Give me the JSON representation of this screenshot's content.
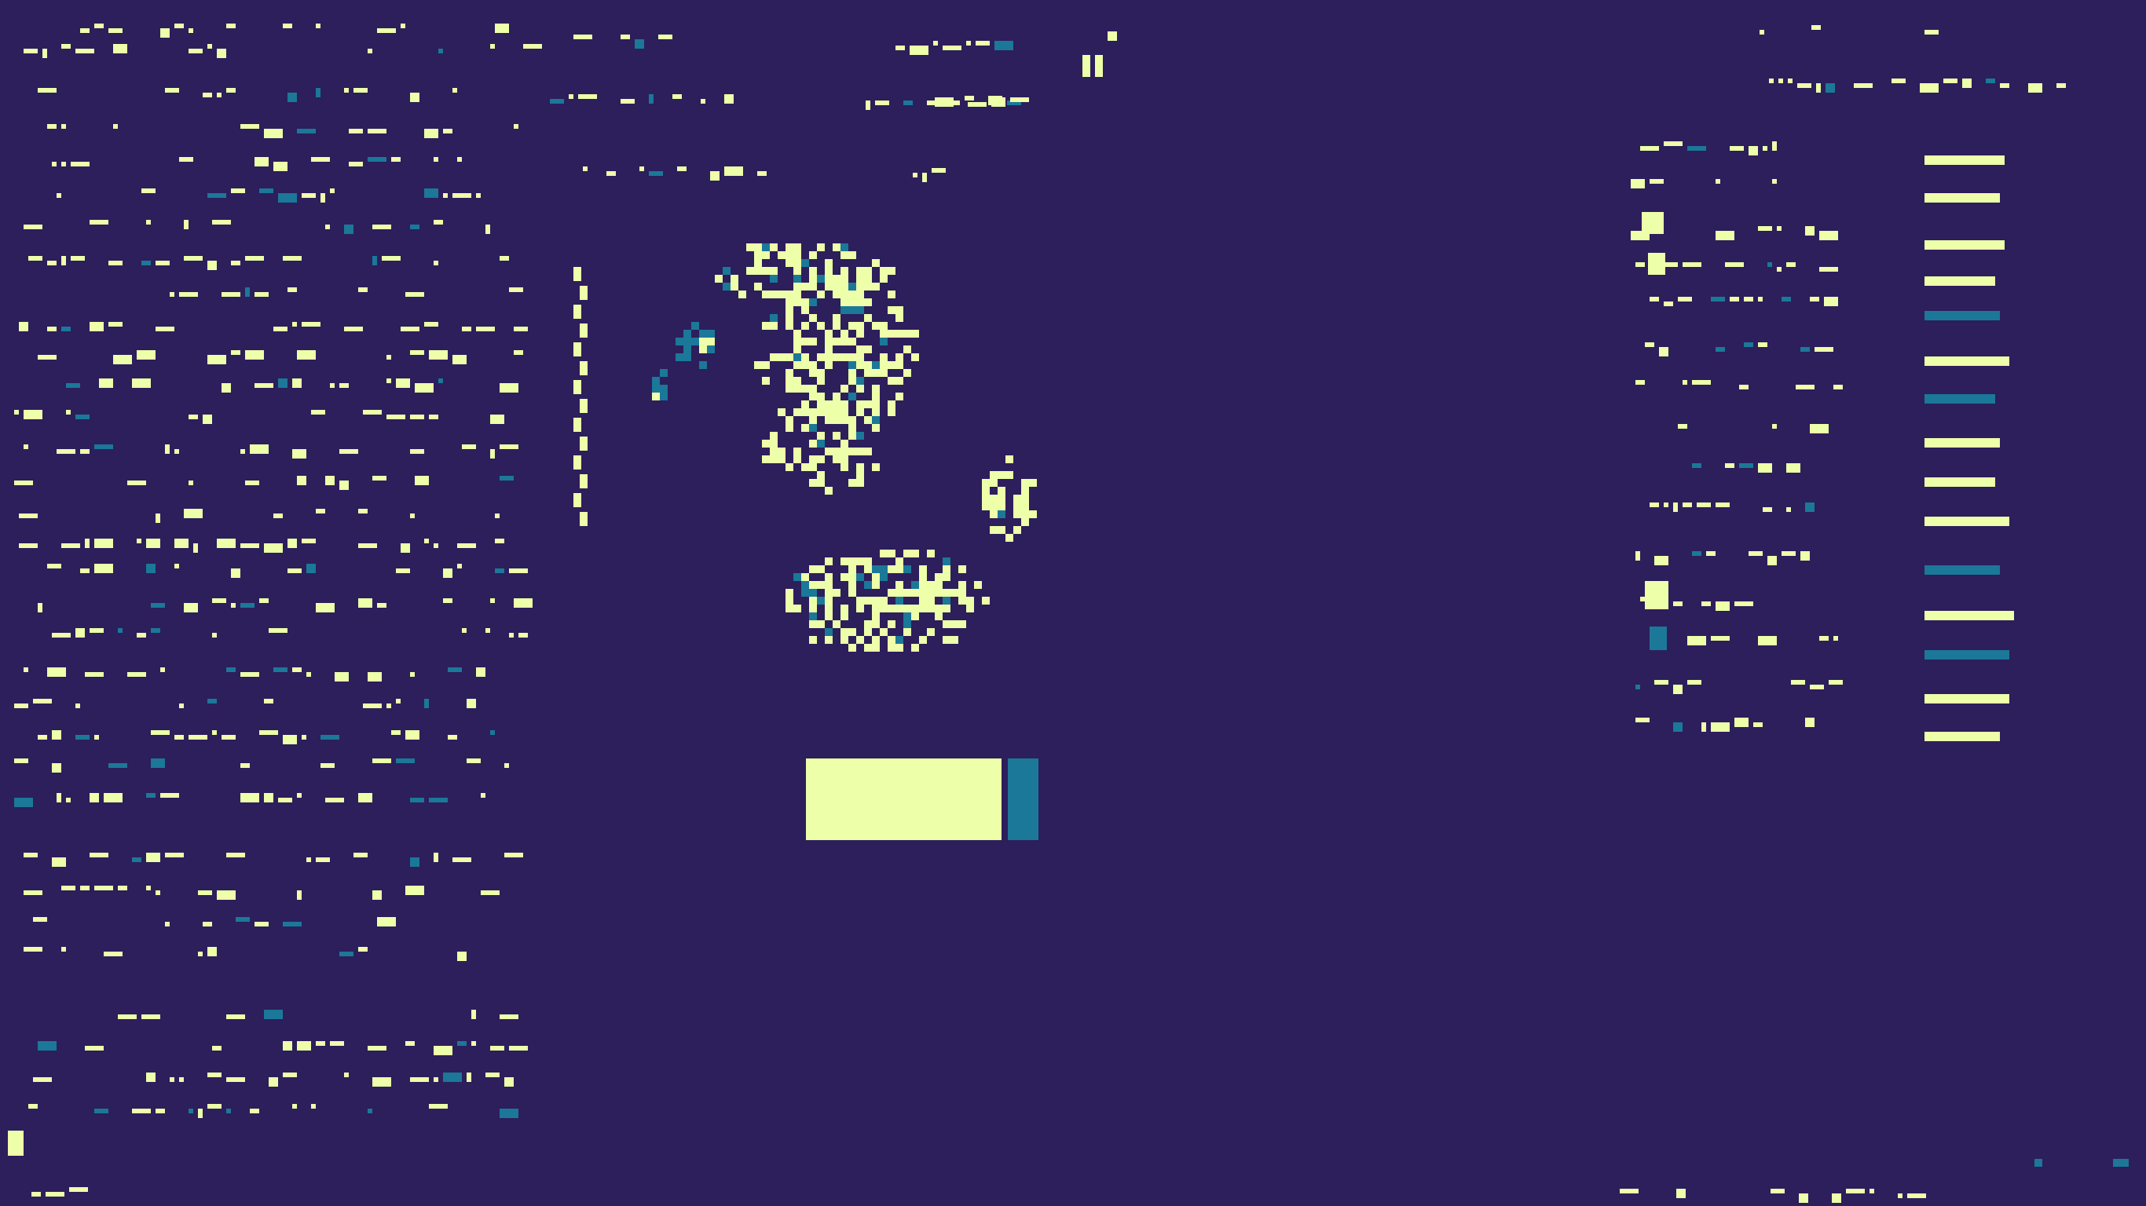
{
  "screen": {
    "background_color": "#2d1e5c",
    "foreground_color": "#eeffaa",
    "accent_color": "#1b7898"
  },
  "hud": {
    "meter_level_fraction": 0.84
  }
}
